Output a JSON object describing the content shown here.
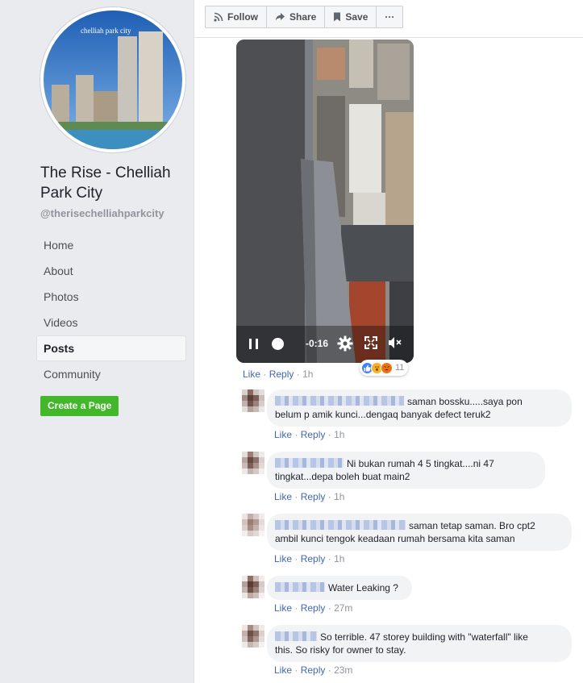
{
  "sidebar": {
    "page_name": "The Rise - Chelliah Park City",
    "handle": "@therisechelliahparkcity",
    "profile_caption": "chelliah park city",
    "nav": [
      {
        "label": "Home",
        "active": false
      },
      {
        "label": "About",
        "active": false
      },
      {
        "label": "Photos",
        "active": false
      },
      {
        "label": "Videos",
        "active": false
      },
      {
        "label": "Posts",
        "active": true
      },
      {
        "label": "Community",
        "active": false
      }
    ],
    "create_page": "Create a Page"
  },
  "toolbar": {
    "follow": "Follow",
    "share": "Share",
    "save": "Save",
    "more": "···"
  },
  "video": {
    "time": "-0:16"
  },
  "post": {
    "like": "Like",
    "reply": "Reply",
    "sep": "·",
    "time": "1h",
    "reaction_count": "11"
  },
  "comments": [
    {
      "text1": "saman bossku.....saya pon",
      "text2": "belum p amik kunci...dengaq banyak defect teruk2",
      "time": "1h"
    },
    {
      "text1": "Ni bukan rumah 4 5 tingkat....ni 47",
      "text2": "tingkat...depa boleh buat main2",
      "time": "1h"
    },
    {
      "text1": "saman tetap saman. Bro cpt2",
      "text2": "ambil kunci tengok keadaan rumah bersama kita saman",
      "time": "1h"
    },
    {
      "text1": "Water Leaking ?",
      "text2": "",
      "time": "27m"
    },
    {
      "text1": "So terrible. 47 storey building with \"waterfall\" like",
      "text2": "this. So risky for owner to stay.",
      "time": "23m"
    }
  ],
  "colors": {
    "sidebar_bg": "#e9ebee",
    "link": "#4267b2",
    "create_btn": "#42b72a",
    "bubble_bg": "#f2f3f5"
  }
}
